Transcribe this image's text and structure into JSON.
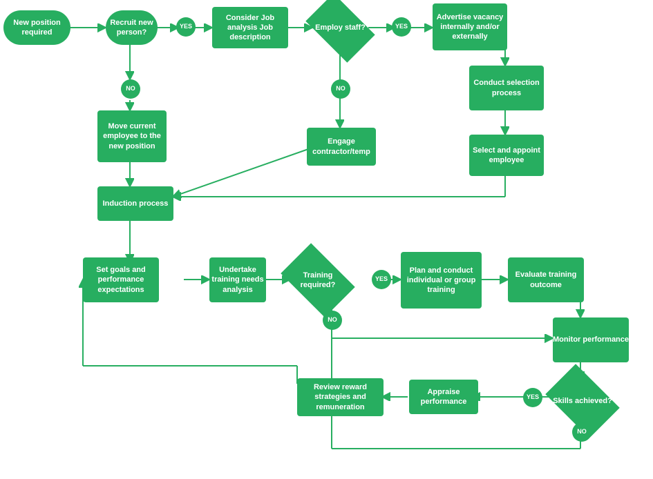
{
  "nodes": {
    "new_position": {
      "label": "New position required"
    },
    "recruit": {
      "label": "Recruit new person?"
    },
    "yes1": {
      "label": "YES"
    },
    "consider": {
      "label": "Consider Job analysis Job description"
    },
    "employ": {
      "label": "Employ staff?"
    },
    "yes2": {
      "label": "YES"
    },
    "advertise": {
      "label": "Advertise vacancy internally and/or externally"
    },
    "conduct_selection": {
      "label": "Conduct selection process"
    },
    "select_appoint": {
      "label": "Select and appoint employee"
    },
    "no1": {
      "label": "NO"
    },
    "move_employee": {
      "label": "Move current employee to the new position"
    },
    "no2": {
      "label": "NO"
    },
    "engage": {
      "label": "Engage contractor/temp"
    },
    "induction": {
      "label": "Induction process"
    },
    "set_goals": {
      "label": "Set goals and performance expectations"
    },
    "undertake": {
      "label": "Undertake training needs analysis"
    },
    "training_req": {
      "label": "Training required?"
    },
    "yes3": {
      "label": "YES"
    },
    "plan_conduct": {
      "label": "Plan and conduct individual or group training"
    },
    "evaluate": {
      "label": "Evaluate training outcome"
    },
    "no3": {
      "label": "NO"
    },
    "monitor": {
      "label": "Monitor performance"
    },
    "skills": {
      "label": "Skills achieved?"
    },
    "yes4": {
      "label": "YES"
    },
    "appraise": {
      "label": "Appraise performance"
    },
    "review": {
      "label": "Review reward strategies and remuneration"
    },
    "no4": {
      "label": "NO"
    }
  },
  "colors": {
    "green": "#27ae60",
    "white": "#ffffff"
  }
}
